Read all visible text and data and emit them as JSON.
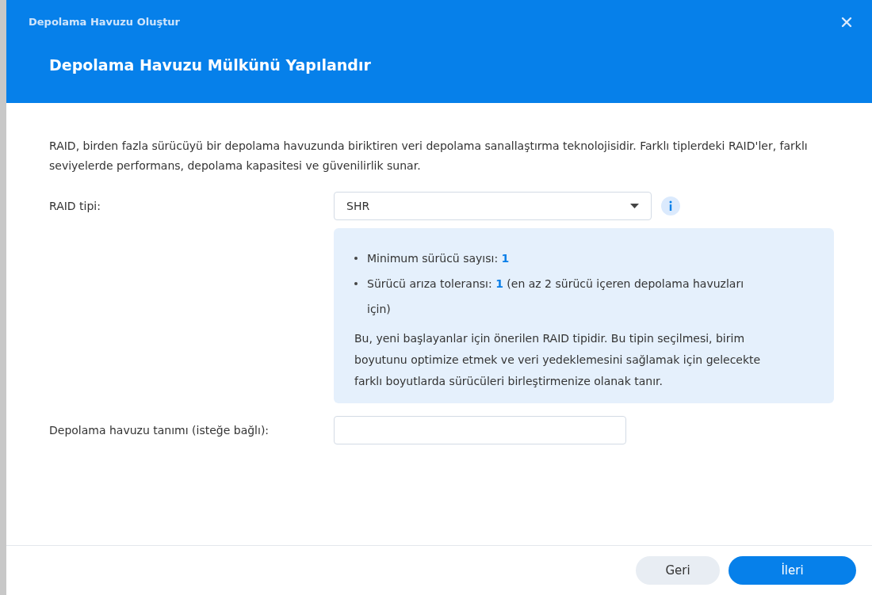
{
  "window": {
    "title": "Depolama Havuzu Oluştur",
    "heading": "Depolama Havuzu Mülkünü Yapılandır"
  },
  "intro": "RAID, birden fazla sürücüyü bir depolama havuzunda biriktiren veri depolama sanallaştırma teknolojisidir. Farklı tiplerdeki RAID'ler, farklı seviyelerde performans, depolama kapasitesi ve güvenilirlik sunar.",
  "raid_type": {
    "label": "RAID tipi:",
    "value": "SHR"
  },
  "info_box": {
    "bullets": [
      "Minimum sürücü sayısı: **1**",
      "Sürücü arıza toleransı: **1** (en az 2 sürücü içeren depolama havuzları için)"
    ],
    "description": "Bu, yeni başlayanlar için önerilen RAID tipidir. Bu tipin seçilmesi, birim boyutunu optimize etmek ve veri yedeklemesini sağlamak için gelecekte farklı boyutlarda sürücüleri birleştirmenize olanak tanır."
  },
  "pool_description": {
    "label": "Depolama havuzu tanımı (isteğe bağlı):"
  },
  "buttons": [
    {
      "label": "Geri",
      "kind": "secondary"
    },
    {
      "label": "İleri",
      "kind": "primary"
    }
  ]
}
